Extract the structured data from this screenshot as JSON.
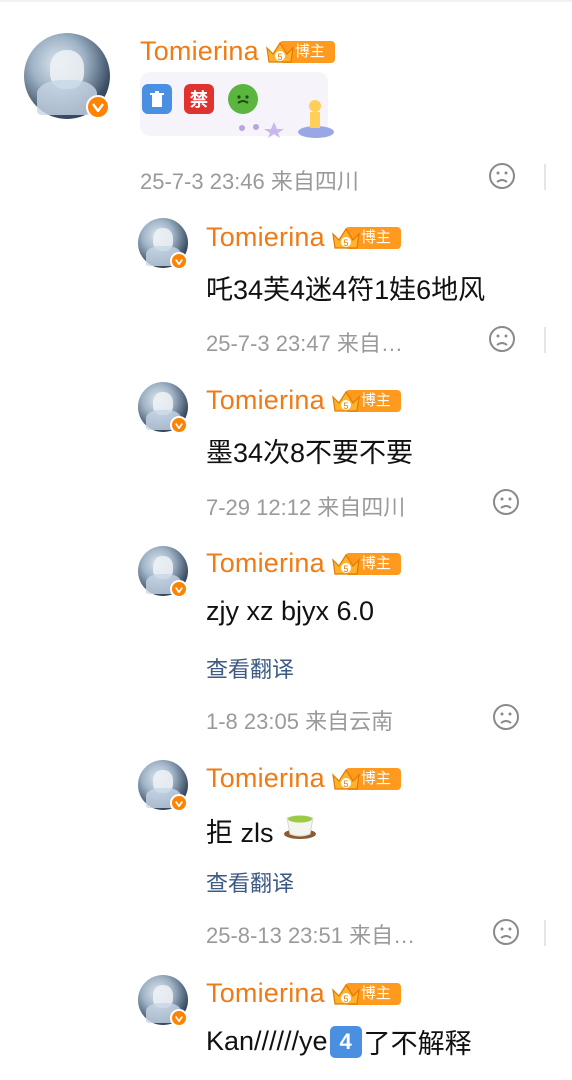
{
  "comments": [
    {
      "username": "Tomierina",
      "badge": "博主",
      "text": "",
      "emojis": [
        "trash-can-icon",
        "prohibited-icon",
        "nauseated-face-icon"
      ],
      "sticker": "little-prince-sticker",
      "meta": "25-7-3 23:46  来自四川"
    },
    {
      "username": "Tomierina",
      "badge": "博主",
      "text": "吒34芙4迷4符1娃6地风",
      "meta": "25-7-3 23:47  来自…"
    },
    {
      "username": "Tomierina",
      "badge": "博主",
      "text": "墨34次8不要不要",
      "meta": "7-29 12:12  来自四川"
    },
    {
      "username": "Tomierina",
      "badge": "博主",
      "text": "zjy xz bjyx 6.0",
      "translate": "查看翻译",
      "meta": "1-8 23:05  来自云南"
    },
    {
      "username": "Tomierina",
      "badge": "博主",
      "text": "拒 zls",
      "emoji": "tea-cup-icon",
      "translate": "查看翻译",
      "meta": "25-8-13 23:51  来自…"
    },
    {
      "username": "Tomierina",
      "badge": "博主",
      "text_before": "Kan//////ye",
      "keycap": "4",
      "text_after": "了不解释"
    }
  ],
  "colors": {
    "username": "#f07a14",
    "badge": "#ff9a1f",
    "meta": "#9a9a9a",
    "link": "#3c5a84"
  }
}
